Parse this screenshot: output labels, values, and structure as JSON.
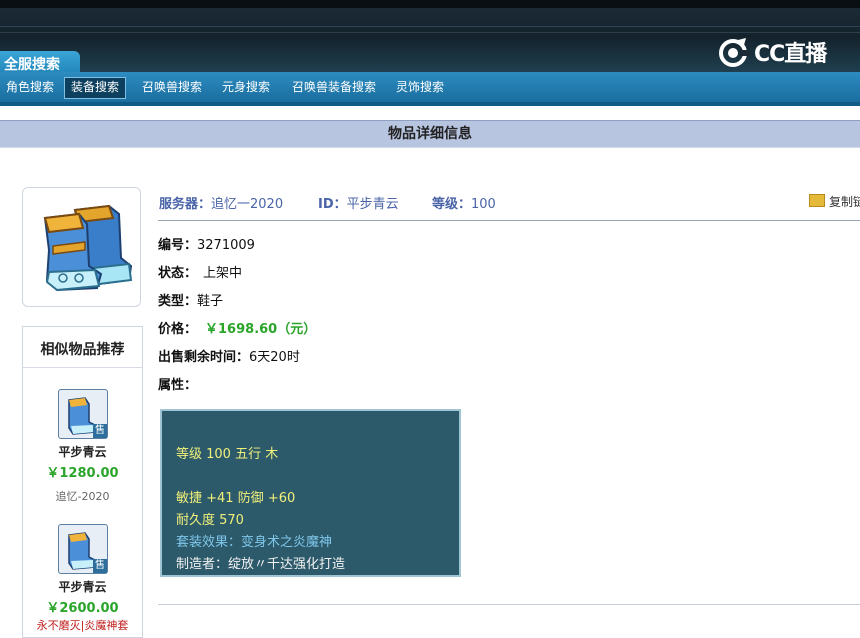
{
  "header": {
    "site_tab": "全服搜索",
    "logo_text": "CC直播"
  },
  "nav": {
    "items": [
      {
        "label": "角色搜索"
      },
      {
        "label": "装备搜索"
      },
      {
        "label": "召唤兽搜索"
      },
      {
        "label": "元身搜索"
      },
      {
        "label": "召唤兽装备搜索"
      },
      {
        "label": "灵饰搜索"
      }
    ],
    "active": "装备搜索"
  },
  "section": {
    "title": "物品详细信息"
  },
  "meta": {
    "server_label": "服务器：",
    "server_value": "追忆一2020",
    "id_label": "ID：",
    "id_value": "平步青云",
    "level_label": "等级：",
    "level_value": "100",
    "copy_label": "复制链"
  },
  "fields": {
    "number_label": "编号：",
    "number_value": "3271009",
    "status_label": "状态：",
    "status_value": "上架中",
    "type_label": "类型：",
    "type_value": "鞋子",
    "price_label": "价格：",
    "price_value": "￥1698.60（元）",
    "time_label": "出售剩余时间：",
    "time_value": "6天20时",
    "attr_label": "属性："
  },
  "attributes": {
    "line1": "等级 100  五行 木",
    "line2": "敏捷 +41  防御 +60",
    "line3": "耐久度 570",
    "line4": "套装效果：变身术之炎魔神",
    "line5": "制造者：绽放〃千达强化打造"
  },
  "recommend": {
    "title": "相似物品推荐",
    "badge": "售",
    "items": [
      {
        "name": "平步青云",
        "price": "￥1280.00",
        "server": "追忆-2020"
      },
      {
        "name": "平步青云",
        "price": "￥2600.00",
        "server": "永不磨灭|炎魔神套"
      }
    ]
  },
  "colors": {
    "accent_blue": "#2d8cc0",
    "price_green": "#2aa52a",
    "attr_bg": "#2d5a6b",
    "section_bar": "#b8c5e0"
  },
  "icons": [
    "boots-icon",
    "folder-icon",
    "cc-logo-icon"
  ]
}
